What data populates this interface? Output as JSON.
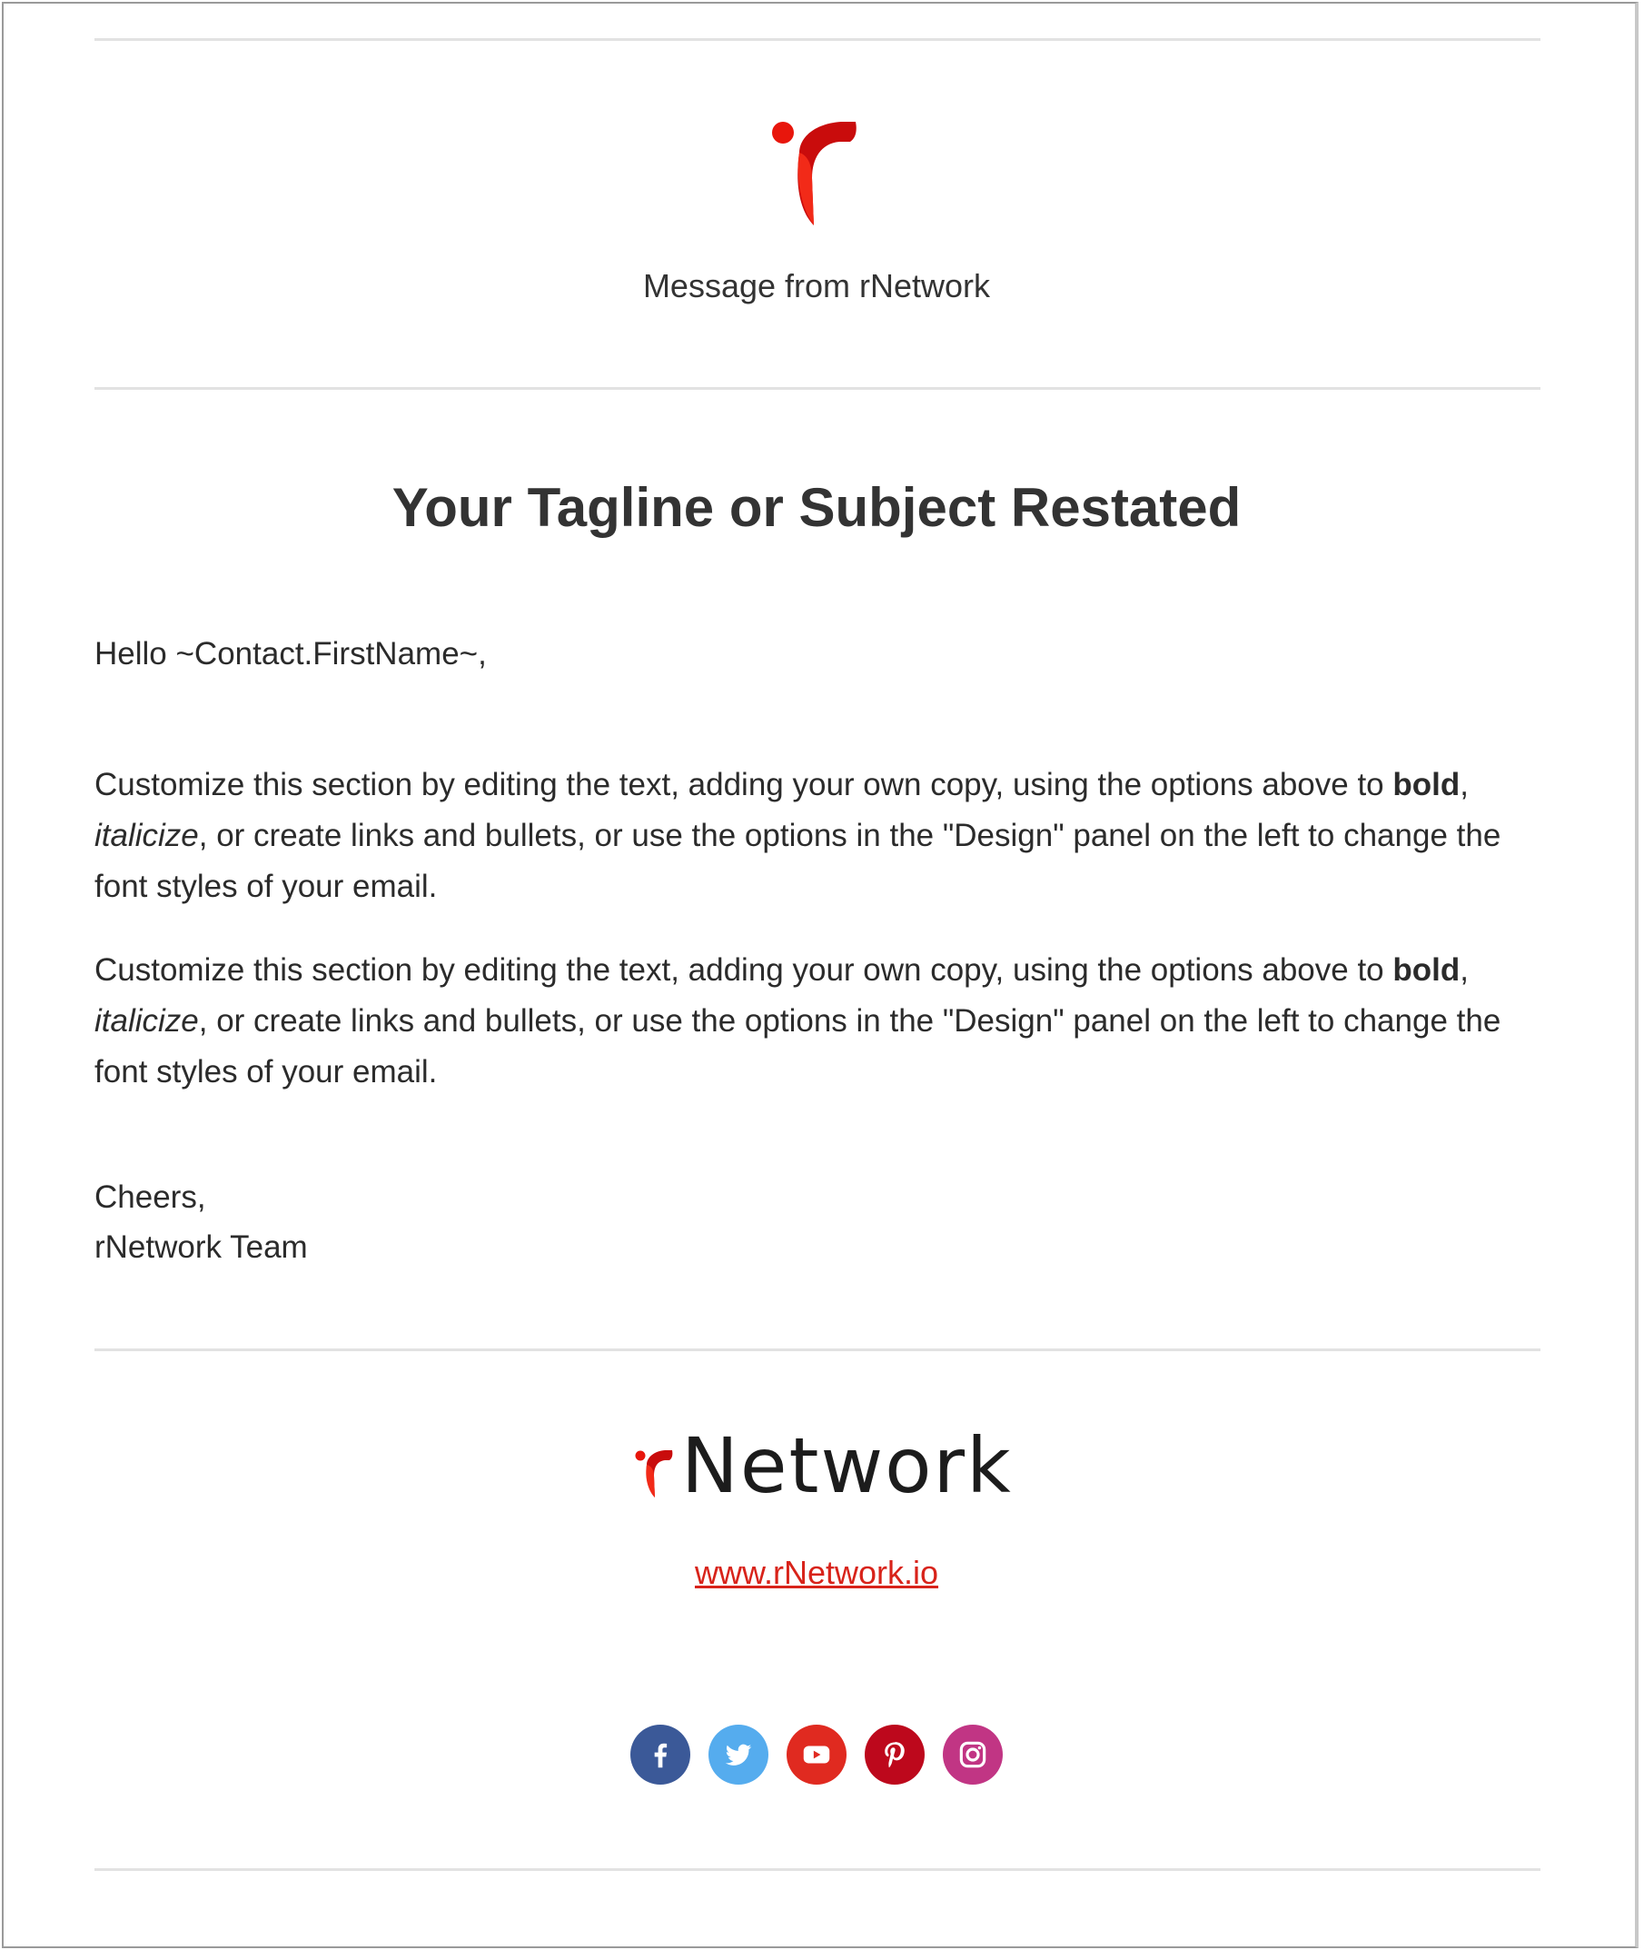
{
  "header": {
    "message_from": "Message from rNetwork"
  },
  "main": {
    "tagline": "Your Tagline or Subject Restated",
    "greeting": "Hello ~Contact.FirstName~,",
    "paragraphs": [
      {
        "pre": "Customize this section by editing the text, adding your own copy, using the options above to ",
        "bold": "bold",
        "mid": ", ",
        "italic": "italicize",
        "post": ", or create links and bullets, or use the options in the \"Design\" panel on the left to change the font styles of your email."
      },
      {
        "pre": "Customize this section by editing the text, adding your own copy, using the options above to ",
        "bold": "bold",
        "mid": ", ",
        "italic": "italicize",
        "post": ", or create links and bullets, or use the options in the \"Design\" panel on the left to change the font styles of your email."
      }
    ],
    "signoff_line1": "Cheers,",
    "signoff_line2": "rNetwork Team"
  },
  "footer": {
    "brand_name": "Network",
    "website": "www.rNetwork.io",
    "social": [
      {
        "icon": "facebook-icon",
        "color": "#3b5998"
      },
      {
        "icon": "twitter-icon",
        "color": "#55acee"
      },
      {
        "icon": "youtube-icon",
        "color": "#e02a20"
      },
      {
        "icon": "pinterest-icon",
        "color": "#bd081c"
      },
      {
        "icon": "instagram-icon",
        "color": "#c13584"
      }
    ]
  },
  "colors": {
    "brand_red": "#e01e12",
    "brand_dark_red": "#b00d0d",
    "link": "#d8231a"
  }
}
